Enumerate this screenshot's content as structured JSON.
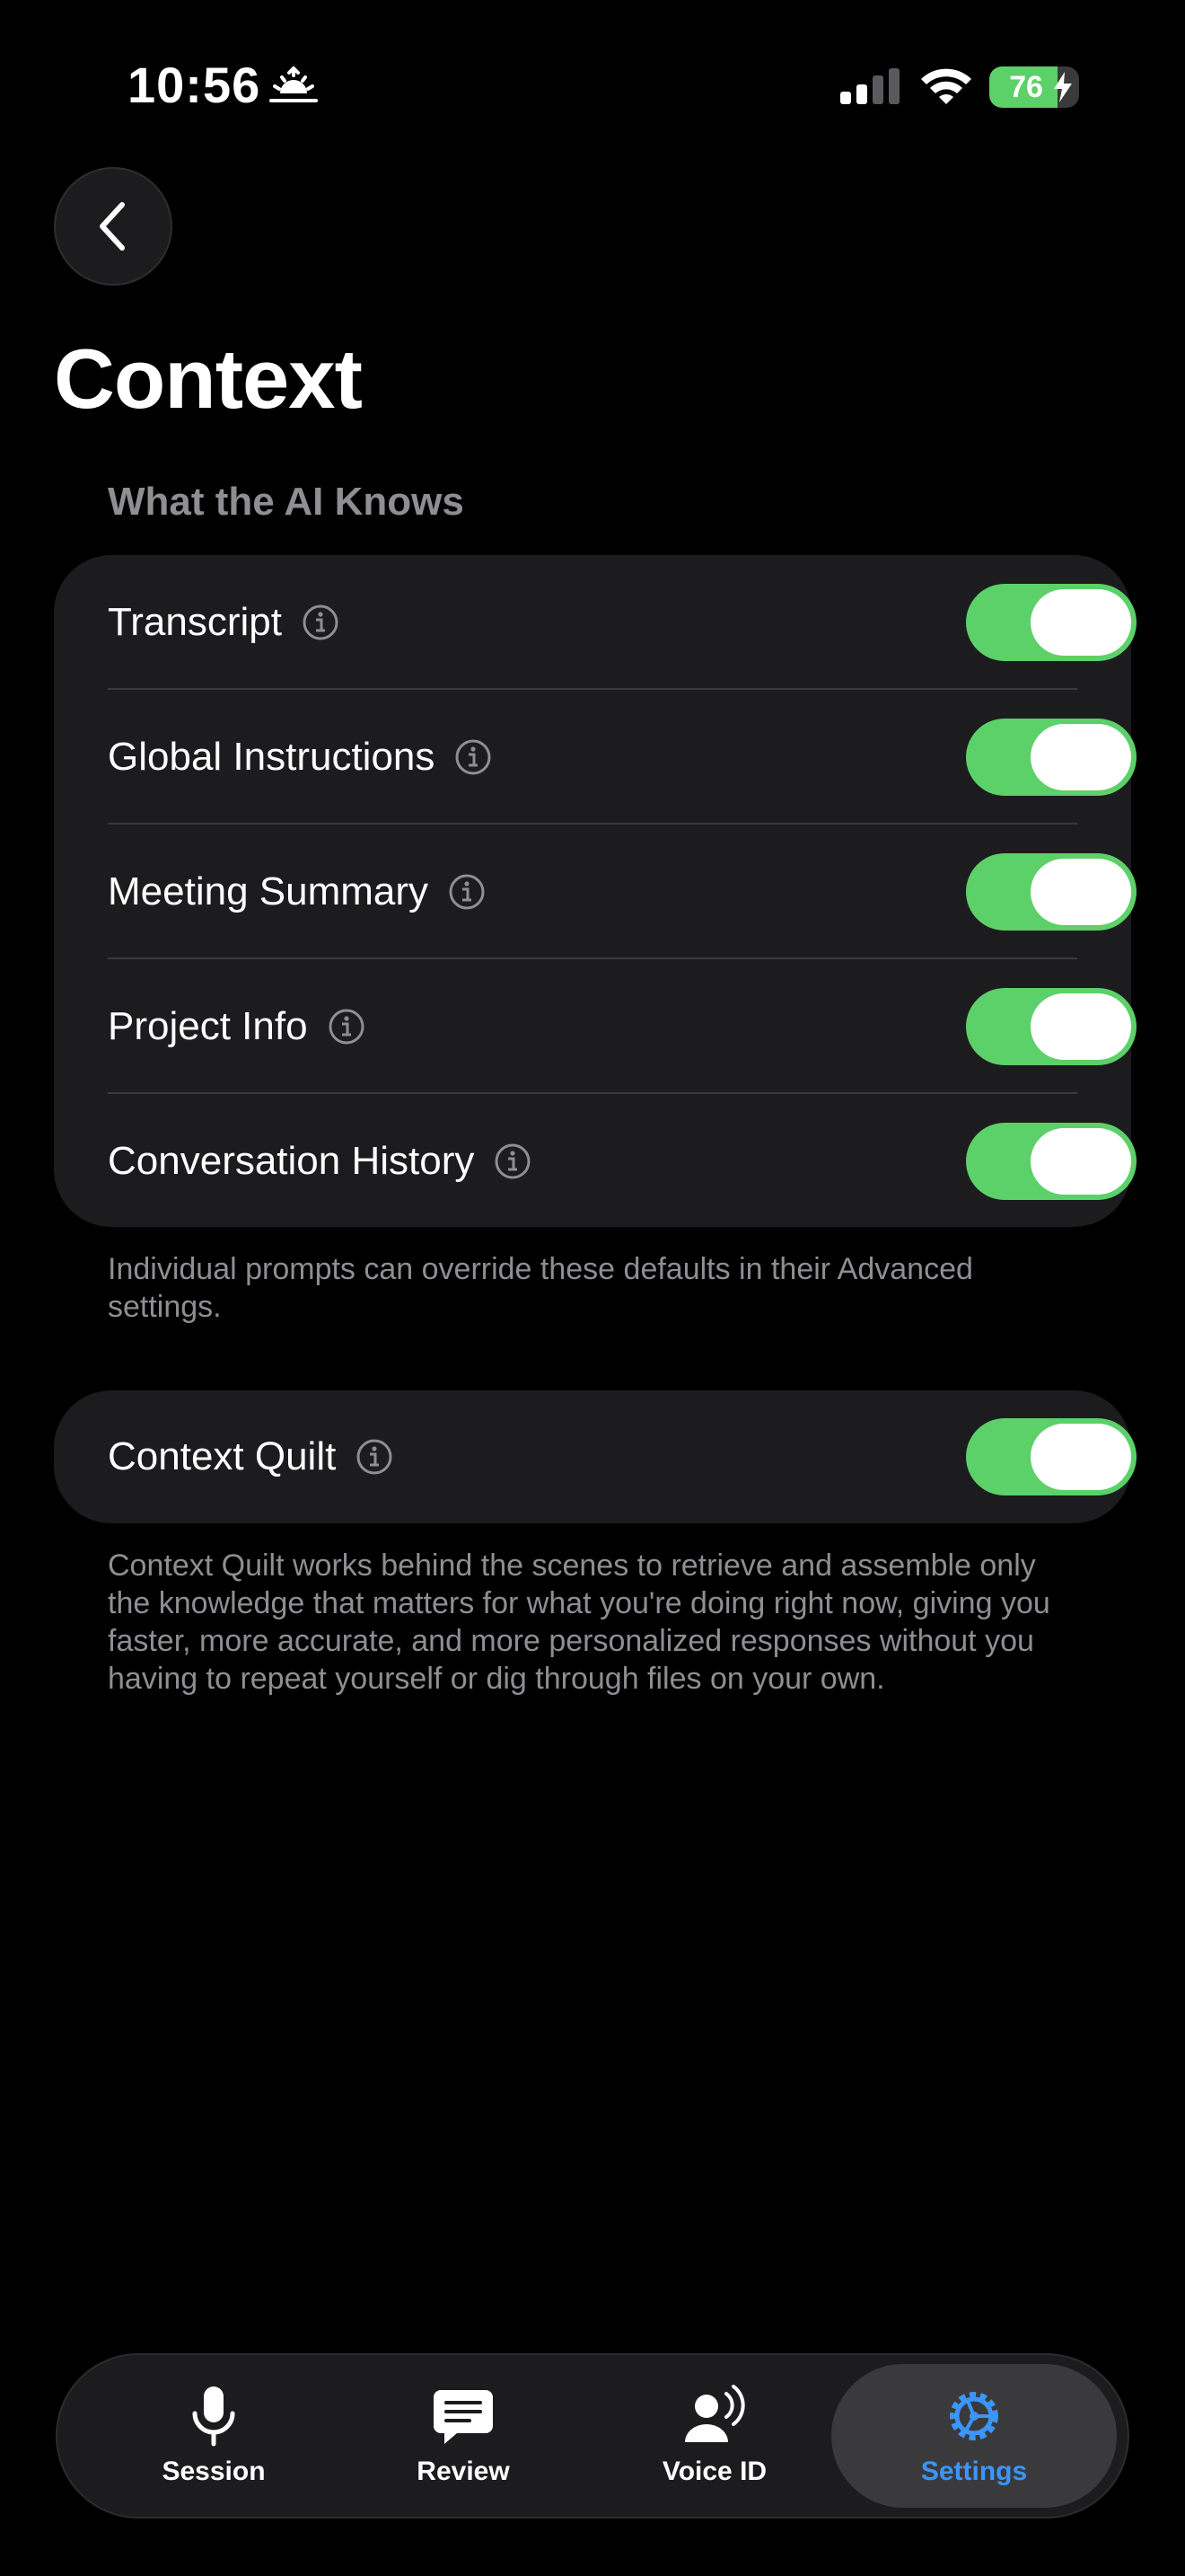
{
  "status_bar": {
    "time": "10:56",
    "battery_level": "76",
    "battery_percent": 76,
    "icons": [
      "sunrise-icon",
      "cellular-signal-icon",
      "wifi-icon",
      "battery-charging-icon"
    ]
  },
  "header": {
    "back_icon": "chevron-left-icon",
    "title": "Context"
  },
  "section": {
    "title": "What the AI Knows",
    "items": [
      {
        "label": "Transcript",
        "enabled": true
      },
      {
        "label": "Global Instructions",
        "enabled": true
      },
      {
        "label": "Meeting Summary",
        "enabled": true
      },
      {
        "label": "Project Info",
        "enabled": true
      },
      {
        "label": "Conversation History",
        "enabled": true
      }
    ],
    "footnote": "Individual prompts can override these defaults in their Advanced settings."
  },
  "quilt": {
    "label": "Context Quilt",
    "enabled": true,
    "description": "Context Quilt works behind the scenes to retrieve and assemble only the knowledge that matters for what you're doing right now, giving you faster, more accurate, and more personalized responses without you having to repeat yourself or dig through files on your own."
  },
  "tab_bar": {
    "tabs": [
      {
        "label": "Session",
        "icon": "microphone-icon"
      },
      {
        "label": "Review",
        "icon": "message-lines-icon"
      },
      {
        "label": "Voice ID",
        "icon": "person-wave-icon"
      },
      {
        "label": "Settings",
        "icon": "gear-icon"
      }
    ],
    "active": "Settings"
  },
  "colors": {
    "background": "#000000",
    "card": "#1c1c1e",
    "toggle_on": "#5cd069",
    "accent": "#3b96ff",
    "secondary_text": "#8e8e93"
  }
}
